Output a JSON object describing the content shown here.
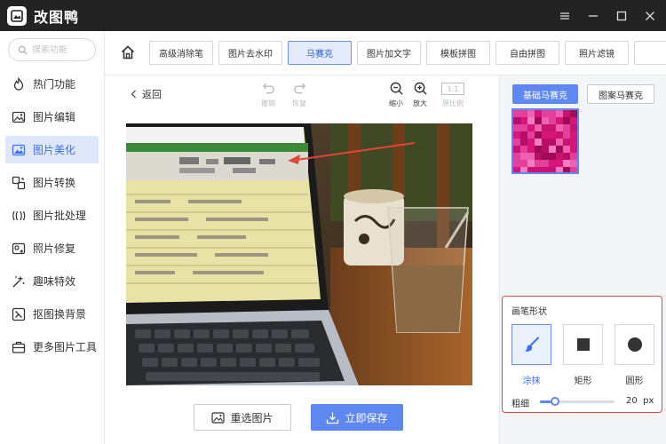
{
  "app": {
    "title": "改图鸭"
  },
  "search": {
    "placeholder": "搜索功能"
  },
  "sidebar": {
    "items": [
      {
        "label": "热门功能",
        "icon": "flame-icon"
      },
      {
        "label": "图片编辑",
        "icon": "image-edit-icon"
      },
      {
        "label": "图片美化",
        "icon": "image-beautify-icon",
        "active": true
      },
      {
        "label": "图片转换",
        "icon": "convert-icon"
      },
      {
        "label": "图片批处理",
        "icon": "batch-icon"
      },
      {
        "label": "照片修复",
        "icon": "photo-repair-icon"
      },
      {
        "label": "趣味特效",
        "icon": "sparkle-icon"
      },
      {
        "label": "抠图换背景",
        "icon": "cutout-icon"
      },
      {
        "label": "更多图片工具",
        "icon": "toolbox-icon"
      }
    ]
  },
  "tabs": [
    {
      "label": "高级消除笔"
    },
    {
      "label": "图片去水印"
    },
    {
      "label": "马赛克",
      "active": true
    },
    {
      "label": "图片加文字"
    },
    {
      "label": "模板拼图"
    },
    {
      "label": "自由拼图"
    },
    {
      "label": "照片滤镜"
    }
  ],
  "canvas": {
    "back_label": "返回",
    "undo_label": "撤销",
    "redo_label": "恢复",
    "zoom_out_label": "缩小",
    "zoom_in_label": "放大",
    "ratio_box": "1:1",
    "ratio_label": "原比例"
  },
  "actions": {
    "reselect_label": "重选图片",
    "save_label": "立即保存"
  },
  "mosaic": {
    "basic_label": "基础马赛克",
    "pattern_label": "图案马赛克"
  },
  "brush": {
    "title": "画笔形状",
    "shapes": [
      {
        "label": "涂抹",
        "icon": "brush-icon",
        "active": true
      },
      {
        "label": "矩形",
        "icon": "square-icon"
      },
      {
        "label": "圆形",
        "icon": "circle-icon"
      }
    ],
    "size_label": "粗细",
    "size_value": "20",
    "size_unit": "px",
    "size_fraction": 0.2
  },
  "colors": {
    "accent": "#5f87f2",
    "highlight_border": "#e04a3b",
    "mosaic": "#d6147a"
  }
}
